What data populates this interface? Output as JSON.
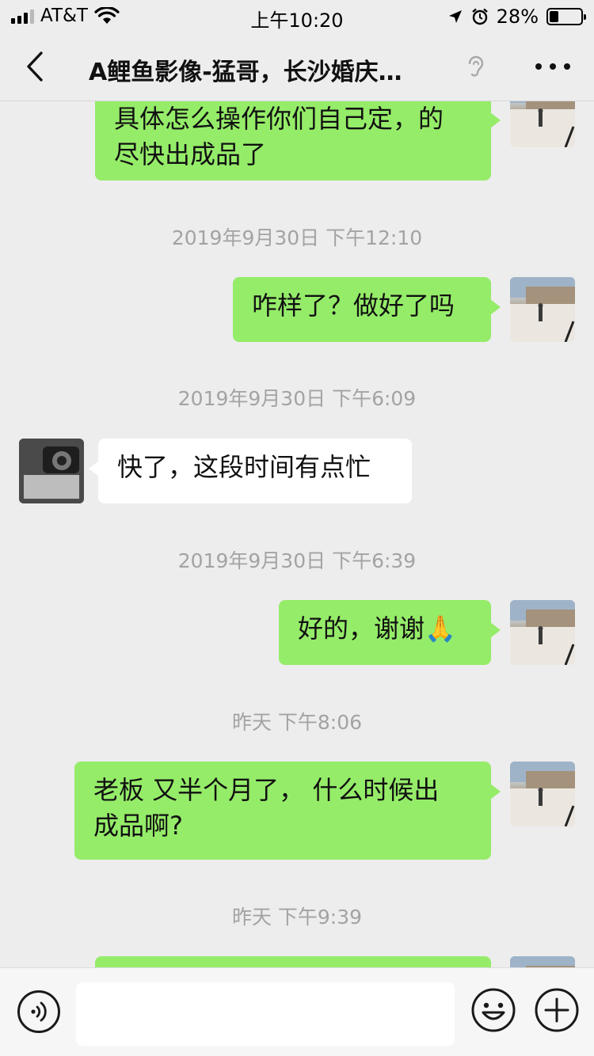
{
  "status_bar": {
    "carrier": "AT&T",
    "time": "上午10:20",
    "battery": "28%",
    "battery_level": 0.28
  },
  "nav": {
    "title": "A鲤鱼影像-猛哥，长沙婚庆…"
  },
  "messages": [
    {
      "type": "me",
      "lines": [
        "具体怎么操作你们自己定，的",
        "尽快出成品了"
      ]
    },
    {
      "type": "time",
      "text": "2019年9月30日 下午12:10"
    },
    {
      "type": "me",
      "lines": [
        "咋样了？做好了吗"
      ]
    },
    {
      "type": "time",
      "text": "2019年9月30日 下午6:09"
    },
    {
      "type": "them",
      "lines": [
        "快了，这段时间有点忙"
      ]
    },
    {
      "type": "time",
      "text": "2019年9月30日 下午6:39"
    },
    {
      "type": "me",
      "lines": [
        "好的，谢谢🙏"
      ]
    },
    {
      "type": "time",
      "text": "昨天 下午8:06"
    },
    {
      "type": "me",
      "lines": [
        "老板 又半个月了， 什么时候出",
        "成品啊?"
      ]
    },
    {
      "type": "time",
      "text": "昨天 下午9:39"
    }
  ],
  "icons": {
    "back": "chevron-left-icon",
    "ear": "ear-icon",
    "more": "more-dots-icon",
    "voice": "voice-icon",
    "emoji": "emoji-icon",
    "plus": "plus-icon"
  },
  "colors": {
    "background": "#ededed",
    "my_bubble": "#95ec69",
    "their_bubble": "#ffffff",
    "timestamp": "#a3a3a3"
  }
}
